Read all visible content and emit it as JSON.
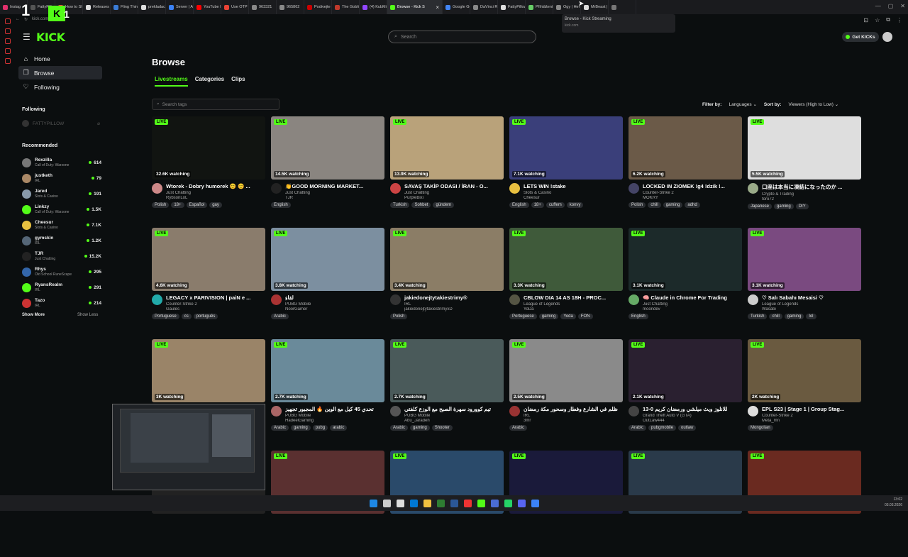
{
  "browser": {
    "tabs": [
      {
        "label": "Instag",
        "color": "#e1306c"
      },
      {
        "label": "FattyPillow",
        "color": "#555"
      },
      {
        "label": "How to Sh",
        "color": "#ea4335"
      },
      {
        "label": "Releases",
        "color": "#ddd"
      },
      {
        "label": "Fling Thing",
        "color": "#3a7bd5"
      },
      {
        "label": "prekladac",
        "color": "#ddd"
      },
      {
        "label": "Server | A",
        "color": "#3b82f6"
      },
      {
        "label": "YouTube M",
        "color": "#ff0000"
      },
      {
        "label": "Use OTP",
        "color": "#ea4335"
      },
      {
        "label": "963321",
        "color": "#888"
      },
      {
        "label": "965862",
        "color": "#888"
      },
      {
        "label": "Podivejte",
        "color": "#c00"
      },
      {
        "label": "The Goblin",
        "color": "#c0392b"
      },
      {
        "label": "(4) KubMi",
        "color": "#9146ff"
      },
      {
        "label": "Browse - Kick S",
        "color": "#53fc18",
        "active": true
      },
      {
        "label": "Google Ge",
        "color": "#4285f4"
      },
      {
        "label": "DaVinci Re",
        "color": "#888"
      },
      {
        "label": "FattyPillow",
        "color": "#ddd"
      },
      {
        "label": "Přihlášení",
        "color": "#6c6"
      },
      {
        "label": "Ogy | Her",
        "color": "#888"
      },
      {
        "label": "MrBeast |",
        "color": "#ddd"
      },
      {
        "label": "",
        "color": "#777"
      }
    ],
    "tooltip_title": "Browse - Kick Streaming",
    "tooltip_url": "kick.com",
    "address": "kick.com/browse"
  },
  "overlay": {
    "stream_num_left": "1",
    "stream_num_right": "1"
  },
  "header": {
    "search_placeholder": "Search",
    "get_kicks": "Get KICKs",
    "logo": "KICK"
  },
  "sidebar": {
    "nav": [
      {
        "label": "Home",
        "icon": "⌂"
      },
      {
        "label": "Browse",
        "icon": "❐"
      },
      {
        "label": "Following",
        "icon": "♡"
      }
    ],
    "following_title": "Following",
    "following_item": "FATTYPILLOW",
    "recommended_title": "Recommended",
    "recommended": [
      {
        "name": "Rexzilla",
        "cat": "Call of Duty: Warzone",
        "viewers": "614",
        "color": "#777"
      },
      {
        "name": "justketh",
        "cat": "IRL",
        "viewers": "79",
        "color": "#aa8866"
      },
      {
        "name": "Jared",
        "cat": "Slots & Casino",
        "viewers": "191",
        "color": "#8899aa"
      },
      {
        "name": "Linkzy",
        "cat": "Call of Duty: Warzone",
        "viewers": "1.5K",
        "color": "#53fc18"
      },
      {
        "name": "Cheesur",
        "cat": "Slots & Casino",
        "viewers": "7.1K",
        "color": "#e8c040"
      },
      {
        "name": "gymskin",
        "cat": "IRL",
        "viewers": "1.2K",
        "color": "#556677"
      },
      {
        "name": "TJR",
        "cat": "Just Chatting",
        "viewers": "15.2K",
        "color": "#222"
      },
      {
        "name": "Rhys",
        "cat": "Old School RuneScape",
        "viewers": "295",
        "color": "#3366aa"
      },
      {
        "name": "RyansRealm",
        "cat": "IRL",
        "viewers": "291",
        "color": "#53fc18"
      },
      {
        "name": "Tazo",
        "cat": "IRL",
        "viewers": "214",
        "color": "#cc3333"
      }
    ],
    "show_more": "Show More",
    "show_less": "Show Less"
  },
  "main": {
    "title": "Browse",
    "tabs": [
      "Livestreams",
      "Categories",
      "Clips"
    ],
    "tags_placeholder": "Search tags",
    "filter_label": "Filter by:",
    "filter_value": "Languages",
    "sort_label": "Sort by:",
    "sort_value": "Viewers (High to Low)",
    "live_label": "LIVE",
    "cards": [
      {
        "title": "Wtorek - Dobry humorek 😊 😊 ...",
        "category": "Just Chatting",
        "channel": "RybsonLoL",
        "watching": "32.6K watching",
        "tags": [
          "Polish",
          "18+",
          "Español",
          "gay"
        ],
        "thumb": "#111411",
        "av": "#c88"
      },
      {
        "title": "👏GOOD MORNING MARKET...",
        "category": "Just Chatting",
        "channel": "TJR",
        "watching": "14.5K watching",
        "tags": [
          "English"
        ],
        "thumb": "#8a8580",
        "av": "#222"
      },
      {
        "title": "SAVAŞ TAKİP ODASI / İRAN - O...",
        "category": "Just Chatting",
        "channel": "PurpleBixi",
        "watching": "13.9K watching",
        "tags": [
          "Turkish",
          "Sohbet",
          "gündem"
        ],
        "thumb": "#b9a27a",
        "av": "#c44"
      },
      {
        "title": "LETS WIN !stake",
        "category": "Slots & Casino",
        "channel": "Cheesur",
        "watching": "7.1K watching",
        "tags": [
          "English",
          "18+",
          "cuffem",
          "konvy"
        ],
        "thumb": "#3a3f7a",
        "av": "#e8c040"
      },
      {
        "title": "LOCKED IN ZIOMEK !g4 !dzik !...",
        "category": "Counter-Strike 2",
        "channel": "MOKRY",
        "watching": "6.2K watching",
        "tags": [
          "Polish",
          "chill",
          "gaming",
          "adhd"
        ],
        "thumb": "#6b5a48",
        "av": "#446"
      },
      {
        "title": "口座は本当に凍結になったのか ...",
        "category": "Crypto & Trading",
        "channel": "toro72",
        "watching": "5.5K watching",
        "tags": [
          "Japanese",
          "gaming",
          "DIY"
        ],
        "thumb": "#dedede",
        "av": "#9a8"
      },
      {
        "title": "LEGACY x PARIVISION | paiN e ...",
        "category": "Counter-Strike 2",
        "channel": "Gaules",
        "watching": "4.6K watching",
        "tags": [
          "Portuguese",
          "cs",
          "português"
        ],
        "thumb": "#8a7c6c",
        "av": "#2aa"
      },
      {
        "title": "لقاءِ",
        "category": "PUBG Mobile",
        "channel": "NoorGamer",
        "watching": "3.8K watching",
        "tags": [
          "Arabic"
        ],
        "thumb": "#7c8fa0",
        "av": "#a33"
      },
      {
        "title": "jakiedonejtytakiestrimy®",
        "category": "IRL",
        "channel": "jakiedonejtytakiestrimyxD",
        "watching": "3.4K watching",
        "tags": [
          "Polish"
        ],
        "thumb": "#8b7d66",
        "av": "#333"
      },
      {
        "title": "CBLOW DIA 14 AS 18H - PROC...",
        "category": "League of Legends",
        "channel": "YoDa",
        "watching": "3.3K watching",
        "tags": [
          "Portuguese",
          "gaming",
          "Yoda",
          "FON"
        ],
        "thumb": "#3f5a3a",
        "av": "#554"
      },
      {
        "title": "🧠 Claude in Chrome For Trading",
        "category": "Just Chatting",
        "channel": "moondev",
        "watching": "3.1K watching",
        "tags": [
          "English"
        ],
        "thumb": "#1c2a2a",
        "av": "#6a6"
      },
      {
        "title": "♡ Salı Sabahı Mesaisi ♡",
        "category": "League of Legends",
        "channel": "Wasabi",
        "watching": "3.1K watching",
        "tags": [
          "Turkish",
          "chill",
          "gaming",
          "lol"
        ],
        "thumb": "#7a4a80",
        "av": "#ccc"
      },
      {
        "title": "",
        "category": "",
        "channel": "",
        "watching": "3K watching",
        "tags": [],
        "thumb": "#9a8468",
        "av": "#333"
      },
      {
        "title": "تحدي 45 كيل مع الوين 🔥 المجبور تجهيز",
        "category": "PUBG Mobile",
        "channel": "HadeelGaming",
        "watching": "2.7K watching",
        "tags": [
          "Arabic",
          "gaming",
          "pubg",
          "arabic"
        ],
        "thumb": "#6a8a9a",
        "av": "#a66"
      },
      {
        "title": "تيم كوورود سهرة الصبح مع الوزع كلفتي",
        "category": "PUBG Mobile",
        "channel": "Abu_Jaradeh",
        "watching": "2.7K watching",
        "tags": [
          "Arabic",
          "gaming",
          "Shooter"
        ],
        "thumb": "#4a5a5a",
        "av": "#555"
      },
      {
        "title": "ظلم في الشارع وفطار وسحور مكة رمضان",
        "category": "IRL",
        "channel": "3mr",
        "watching": "2.5K watching",
        "tags": [
          "Arabic"
        ],
        "thumb": "#8a8a8a",
        "av": "#933"
      },
      {
        "title": "13-0 للانلوز ويث ميلشي ورمضان كريم",
        "category": "Grand Theft Auto V (GTA)",
        "channel": "OutLaw444",
        "watching": "2.1K watching",
        "tags": [
          "Arabic",
          "pubgmobile",
          "outlaw"
        ],
        "thumb": "#2a2030",
        "av": "#444"
      },
      {
        "title": "EPL S23 | Stage 1 | Group Stag...",
        "category": "Counter-Strike 2",
        "channel": "Meta_mn",
        "watching": "2K watching",
        "tags": [
          "Mongolian"
        ],
        "thumb": "#6a5a40",
        "av": "#ddd"
      },
      {
        "title": "",
        "category": "",
        "channel": "",
        "watching": "",
        "tags": [],
        "thumb": "#222",
        "av": "#333"
      },
      {
        "title": "",
        "category": "",
        "channel": "",
        "watching": "",
        "tags": [],
        "thumb": "#5a3030",
        "av": "#333"
      },
      {
        "title": "",
        "category": "",
        "channel": "",
        "watching": "",
        "tags": [],
        "thumb": "#2a4a6a",
        "av": "#333"
      },
      {
        "title": "",
        "category": "",
        "channel": "",
        "watching": "",
        "tags": [],
        "thumb": "#1a1a3a",
        "av": "#333"
      },
      {
        "title": "",
        "category": "",
        "channel": "",
        "watching": "",
        "tags": [],
        "thumb": "#2a3a4a",
        "av": "#333"
      },
      {
        "title": "",
        "category": "",
        "channel": "",
        "watching": "",
        "tags": [],
        "thumb": "#6a2a20",
        "av": "#333"
      }
    ]
  },
  "taskbar": {
    "time": "13:02",
    "date": "03.03.2026",
    "icons": [
      "#1e88e5",
      "#ccc",
      "#ddd",
      "#0078d4",
      "#f0c040",
      "#2e7d32",
      "#2b5797",
      "#e33",
      "#53fc18",
      "#4a6cd4",
      "#25d366",
      "#5865f2",
      "#3b82f6"
    ]
  }
}
